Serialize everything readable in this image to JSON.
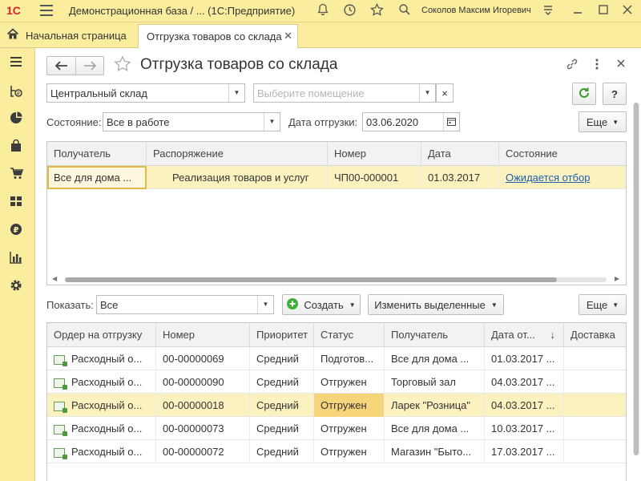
{
  "app": {
    "logo": "1С",
    "title": "Демонстрационная база / ...   (1С:Предприятие)",
    "user": "Соколов Максим Игоревич"
  },
  "tabs": {
    "home_label": "Начальная страница",
    "active_label": "Отгрузка товаров со склада",
    "close_glyph": "✕"
  },
  "form": {
    "title": "Отгрузка товаров со склада",
    "warehouse": "Центральный склад",
    "room_placeholder": "Выберите помещение",
    "clear_glyph": "×",
    "status_label": "Состояние:",
    "status_value": "Все в работе",
    "date_label": "Дата отгрузки:",
    "date_value": "03.06.2020",
    "more_label": "Еще",
    "help_label": "?"
  },
  "orders_table": {
    "headers": [
      "Получатель",
      "Распоряжение",
      "Номер",
      "Дата",
      "Состояние"
    ],
    "rows": [
      [
        "Все для дома ...",
        "Реализация товаров и услуг",
        "ЧП00-000001",
        "01.03.2017",
        "Ожидается отбор"
      ]
    ]
  },
  "toolbar2": {
    "show_label": "Показать:",
    "show_value": "Все",
    "create_label": "Создать",
    "change_label": "Изменить выделенные",
    "more_label": "Еще"
  },
  "shipments_table": {
    "headers": [
      "Ордер на отгрузку",
      "Номер",
      "Приоритет",
      "Статус",
      "Получатель",
      "Дата от...",
      "Доставка"
    ],
    "sort_glyph": "↓",
    "rows": [
      [
        "Расходный о...",
        "00-00000069",
        "Средний",
        "Подготов...",
        "Все для дома ...",
        "01.03.2017 ...",
        ""
      ],
      [
        "Расходный о...",
        "00-00000090",
        "Средний",
        "Отгружен",
        "Торговый зал",
        "04.03.2017 ...",
        ""
      ],
      [
        "Расходный о...",
        "00-00000018",
        "Средний",
        "Отгружен",
        "Ларек \"Розница\"",
        "04.03.2017 ...",
        ""
      ],
      [
        "Расходный о...",
        "00-00000073",
        "Средний",
        "Отгружен",
        "Все для дома ...",
        "10.03.2017 ...",
        ""
      ],
      [
        "Расходный о...",
        "00-00000072",
        "Средний",
        "Отгружен",
        "Магазин \"Быто...",
        "17.03.2017 ...",
        ""
      ]
    ],
    "selected_row": 2
  },
  "colors": {
    "panel": "#fbed9e",
    "selected_row": "#fbf2c0",
    "status_highlight": "#f6d57a",
    "link": "#1d5fb0",
    "refresh_green": "#3a9a2a",
    "create_green": "#3cae3a",
    "logo_red": "#d8232a"
  },
  "icons": {
    "sidebar": [
      "menu-icon",
      "operations-icon",
      "reports-icon",
      "purchases-icon",
      "sales-icon",
      "warehouse-icon",
      "finance-icon",
      "analytics-icon",
      "settings-icon"
    ]
  }
}
